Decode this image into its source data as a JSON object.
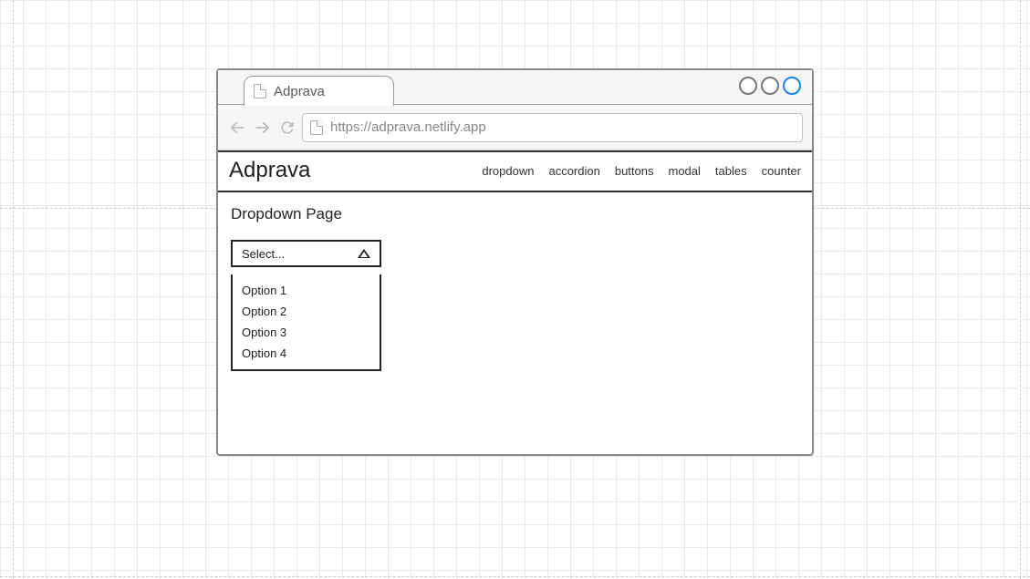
{
  "browser": {
    "tab_title": "Adprava",
    "url": "https://adprava.netlify.app"
  },
  "navbar": {
    "brand": "Adprava",
    "links": [
      "dropdown",
      "accordion",
      "buttons",
      "modal",
      "tables",
      "counter"
    ]
  },
  "page": {
    "heading": "Dropdown Page"
  },
  "dropdown": {
    "placeholder": "Select...",
    "options": [
      "Option 1",
      "Option 2",
      "Option 3",
      "Option 4"
    ]
  }
}
